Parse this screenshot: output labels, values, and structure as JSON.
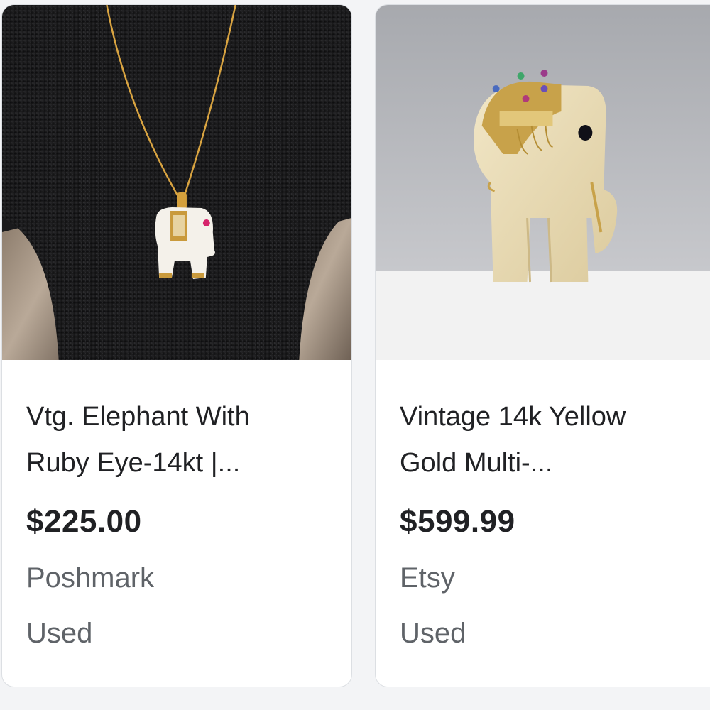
{
  "products": [
    {
      "title_line1": "Vtg. Elephant With",
      "title_line2": "Ruby Eye-14kt |...",
      "price": "$225.00",
      "seller": "Poshmark",
      "condition": "Used",
      "image_icon": "elephant-pendant-necklace-photo"
    },
    {
      "title_line1": "Vintage 14k Yellow",
      "title_line2": "Gold Multi-...",
      "price": "$599.99",
      "seller": "Etsy",
      "condition": "Used",
      "image_icon": "elephant-brooch-photo"
    }
  ],
  "colors": {
    "card_bg": "#ffffff",
    "title_text": "#202124",
    "muted_text": "#5f6368",
    "page_bg": "#f3f4f6"
  }
}
